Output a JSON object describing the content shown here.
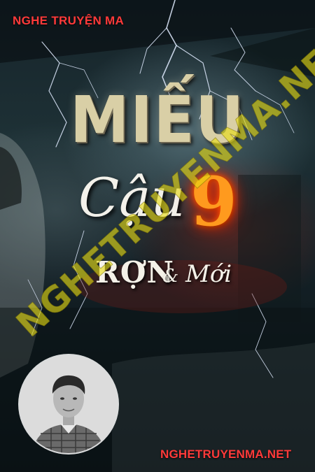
{
  "cover": {
    "site_name_top": "NGHE TRUYỆN MA",
    "title_line1": "MIẾU",
    "title_line2": "Cậu",
    "title_number": "9",
    "tagline_word1": "RỢN",
    "tagline_amp": "&",
    "tagline_word2": "Mới",
    "watermark": "NGHETRUYENMA.NET",
    "site_url_bottom": "NGHETRUYENMA.NET",
    "avatar_icon": "narrator-portrait",
    "colors": {
      "site_text": "#ff3a3a",
      "watermark": "#e6dc14",
      "title": "#d9cfa6",
      "fire_number": "#ff9a1e"
    }
  }
}
